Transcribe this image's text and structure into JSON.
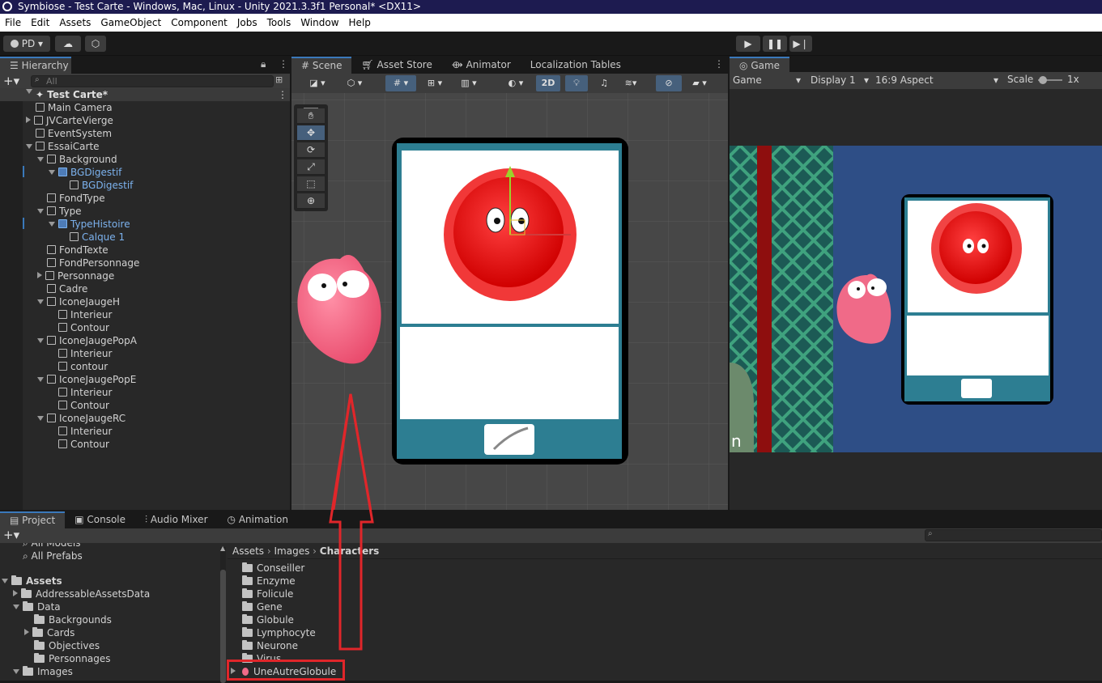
{
  "window": {
    "title": "Symbiose - Test Carte - Windows, Mac, Linux - Unity 2021.3.3f1 Personal* <DX11>"
  },
  "menu": [
    "File",
    "Edit",
    "Assets",
    "GameObject",
    "Component",
    "Jobs",
    "Tools",
    "Window",
    "Help"
  ],
  "toolbar": {
    "account": "PD"
  },
  "hierarchy": {
    "tab": "Hierarchy",
    "search_placeholder": "All",
    "scene_name": "Test Carte*",
    "items": [
      {
        "label": "Main Camera",
        "depth": 1,
        "expand": "none",
        "color": "normal"
      },
      {
        "label": "JVCarteVierge",
        "depth": 1,
        "expand": "collapsed",
        "color": "normal"
      },
      {
        "label": "EventSystem",
        "depth": 1,
        "expand": "none",
        "color": "normal"
      },
      {
        "label": "EssaiCarte",
        "depth": 1,
        "expand": "expanded",
        "color": "normal"
      },
      {
        "label": "Background",
        "depth": 2,
        "expand": "expanded",
        "color": "normal"
      },
      {
        "label": "BGDigestif",
        "depth": 3,
        "expand": "expanded",
        "color": "blue"
      },
      {
        "label": "BGDigestif",
        "depth": 4,
        "expand": "none",
        "color": "blue"
      },
      {
        "label": "FondType",
        "depth": 2,
        "expand": "none",
        "color": "normal"
      },
      {
        "label": "Type",
        "depth": 2,
        "expand": "expanded",
        "color": "normal"
      },
      {
        "label": "TypeHistoire",
        "depth": 3,
        "expand": "expanded",
        "color": "blue"
      },
      {
        "label": "Calque 1",
        "depth": 4,
        "expand": "none",
        "color": "blue"
      },
      {
        "label": "FondTexte",
        "depth": 2,
        "expand": "none",
        "color": "normal"
      },
      {
        "label": "FondPersonnage",
        "depth": 2,
        "expand": "none",
        "color": "normal"
      },
      {
        "label": "Personnage",
        "depth": 2,
        "expand": "collapsed",
        "color": "normal"
      },
      {
        "label": "Cadre",
        "depth": 2,
        "expand": "none",
        "color": "normal"
      },
      {
        "label": "IconeJaugeH",
        "depth": 2,
        "expand": "expanded",
        "color": "normal"
      },
      {
        "label": "Interieur",
        "depth": 3,
        "expand": "none",
        "color": "normal"
      },
      {
        "label": "Contour",
        "depth": 3,
        "expand": "none",
        "color": "normal"
      },
      {
        "label": "IconeJaugePopA",
        "depth": 2,
        "expand": "expanded",
        "color": "normal"
      },
      {
        "label": "Interieur",
        "depth": 3,
        "expand": "none",
        "color": "normal"
      },
      {
        "label": "contour",
        "depth": 3,
        "expand": "none",
        "color": "normal"
      },
      {
        "label": "IconeJaugePopE",
        "depth": 2,
        "expand": "expanded",
        "color": "normal"
      },
      {
        "label": "Interieur",
        "depth": 3,
        "expand": "none",
        "color": "normal"
      },
      {
        "label": "Contour",
        "depth": 3,
        "expand": "none",
        "color": "normal"
      },
      {
        "label": "IconeJaugeRC",
        "depth": 2,
        "expand": "expanded",
        "color": "normal"
      },
      {
        "label": "Interieur",
        "depth": 3,
        "expand": "none",
        "color": "normal"
      },
      {
        "label": "Contour",
        "depth": 3,
        "expand": "none",
        "color": "normal"
      }
    ]
  },
  "scene": {
    "tabs": [
      "Scene",
      "Asset Store",
      "Animator",
      "Localization Tables"
    ],
    "mode_2d": "2D"
  },
  "game": {
    "tab": "Game",
    "view": "Game",
    "display": "Display 1",
    "aspect": "16:9 Aspect",
    "scale_label": "Scale",
    "scale_value": "1x",
    "partial_text": "n"
  },
  "project": {
    "tabs": [
      "Project",
      "Console",
      "Audio Mixer",
      "Animation"
    ],
    "favorites": [
      "All Models",
      "All Prefabs"
    ],
    "tree": [
      {
        "label": "Assets",
        "depth": 0,
        "expand": "expanded",
        "bold": true
      },
      {
        "label": "AddressableAssetsData",
        "depth": 1,
        "expand": "collapsed"
      },
      {
        "label": "Data",
        "depth": 1,
        "expand": "expanded"
      },
      {
        "label": "Backrgounds",
        "depth": 2,
        "expand": "none"
      },
      {
        "label": "Cards",
        "depth": 2,
        "expand": "collapsed"
      },
      {
        "label": "Objectives",
        "depth": 2,
        "expand": "none"
      },
      {
        "label": "Personnages",
        "depth": 2,
        "expand": "none"
      },
      {
        "label": "Images",
        "depth": 1,
        "expand": "expanded"
      }
    ],
    "breadcrumb": [
      "Assets",
      "Images",
      "Characters"
    ],
    "folders": [
      "Conseiller",
      "Enzyme",
      "Folicule",
      "Gene",
      "Globule",
      "Lymphocyte",
      "Neurone",
      "Virus"
    ],
    "highlighted_item": "UneAutreGlobule"
  },
  "colors": {
    "highlight": "#e0262a",
    "selection_blue": "#7cb2ee",
    "accent": "#3a79bb"
  }
}
